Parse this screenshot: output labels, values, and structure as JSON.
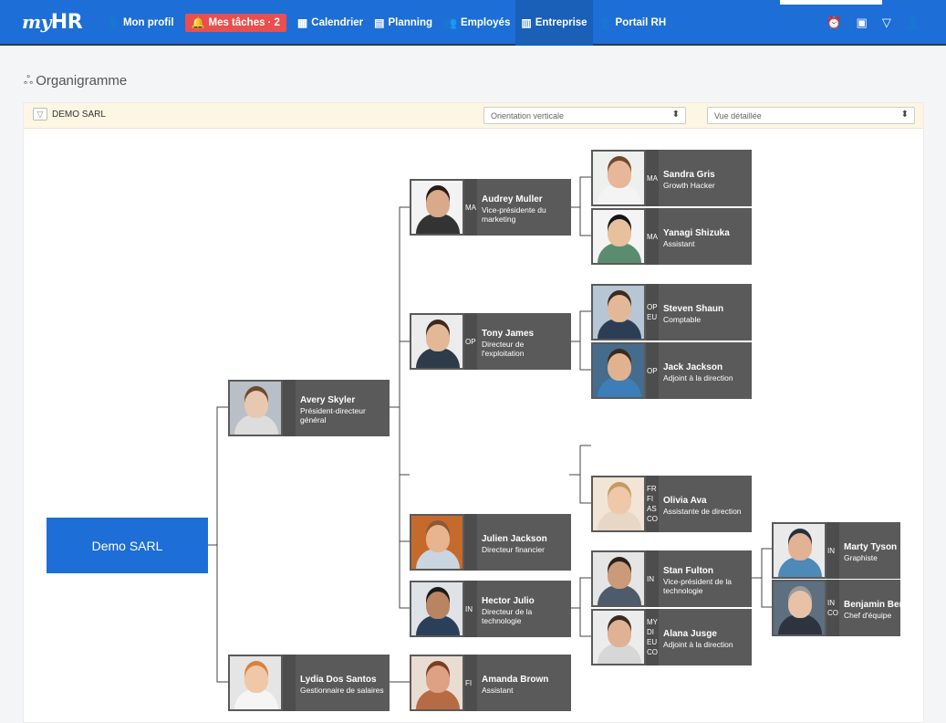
{
  "app": {
    "logo_prefix": "my",
    "logo_suffix": "HR"
  },
  "nav": [
    {
      "label": "Mon profil",
      "icon": "user-icon",
      "glyph": "👤"
    },
    {
      "label": "Mes tâches",
      "icon": "bell-icon",
      "glyph": "🔔",
      "count": "· 2"
    },
    {
      "label": "Calendrier",
      "icon": "calendar-icon",
      "glyph": "▦"
    },
    {
      "label": "Planning",
      "icon": "planning-icon",
      "glyph": "▤"
    },
    {
      "label": "Employés",
      "icon": "employees-icon",
      "glyph": "👥"
    },
    {
      "label": "Entreprise",
      "icon": "building-icon",
      "glyph": "▥"
    },
    {
      "label": "Portail RH",
      "icon": "portal-icon",
      "glyph": "👤"
    }
  ],
  "top_right_icons": [
    {
      "name": "alarm-icon",
      "glyph": "⏰"
    },
    {
      "name": "clipboard-icon",
      "glyph": "▣"
    },
    {
      "name": "filter-icon",
      "glyph": "▽"
    },
    {
      "name": "account-icon",
      "glyph": "👤"
    }
  ],
  "page": {
    "title": "Organigramme",
    "title_icon": "ஃ"
  },
  "toolbar": {
    "company": "DEMO SARL",
    "orientation": "Orientation verticale",
    "view": "Vue détaillée",
    "select_arrow": "⬍",
    "filter_glyph": "▽"
  },
  "org": {
    "root": "Demo SARL",
    "people": [
      {
        "name": "Avery Skyler",
        "title": "Président-directeur général",
        "codes": []
      },
      {
        "name": "Lydia Dos Santos",
        "title": "Gestionnaire de salaires",
        "codes": []
      },
      {
        "name": "Audrey Muller",
        "title": "Vice-présidente du marketing",
        "codes": [
          "MA"
        ]
      },
      {
        "name": "Tony James",
        "title": "Directeur de l'exploitation",
        "codes": [
          "OP"
        ]
      },
      {
        "name": "Julien Jackson",
        "title": "Directeur financier",
        "codes": []
      },
      {
        "name": "Hector Julio",
        "title": "Directeur de la technologie",
        "codes": [
          "IN"
        ]
      },
      {
        "name": "Amanda Brown",
        "title": "Assistant",
        "codes": [
          "FI"
        ]
      },
      {
        "name": "Sandra Gris",
        "title": "Growth Hacker",
        "codes": [
          "MA"
        ]
      },
      {
        "name": "Yanagi Shizuka",
        "title": "Assistant",
        "codes": [
          "MA"
        ]
      },
      {
        "name": "Steven Shaun",
        "title": "Comptable",
        "codes": [
          "OP",
          "EU"
        ]
      },
      {
        "name": "Jack Jackson",
        "title": "Adjoint à la direction",
        "codes": [
          "OP"
        ]
      },
      {
        "name": "Olivia Ava",
        "title": "Assistante de direction",
        "codes": [
          "FR",
          "FI",
          "AS",
          "CO"
        ]
      },
      {
        "name": "Stan Fulton",
        "title": "Vice-président de la technologie",
        "codes": [
          "IN"
        ]
      },
      {
        "name": "Alana Jusge",
        "title": "Adjoint à la direction",
        "codes": [
          "MY",
          "DI",
          "EU",
          "CO"
        ]
      },
      {
        "name": "Marty Tyson",
        "title": "Graphiste",
        "codes": [
          "IN"
        ]
      },
      {
        "name": "Benjamin Ber",
        "title": "Chef d'équipe",
        "codes": [
          "IN",
          "CO"
        ]
      }
    ]
  },
  "colors": {
    "nav_bg": "#1d6ed6",
    "badge": "#e94f4f",
    "card_bg": "#5a5a5a",
    "root_bg": "#1d6ed6",
    "toolbar_bg": "#fdf6e3"
  }
}
